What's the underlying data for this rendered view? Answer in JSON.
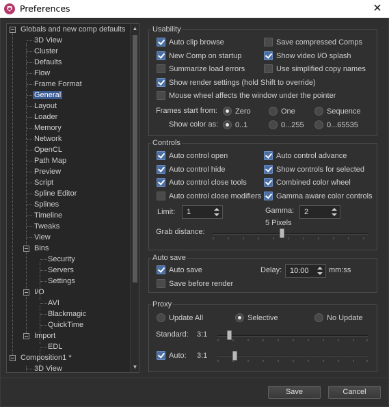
{
  "window": {
    "title": "Preferences"
  },
  "tree": {
    "items": [
      {
        "label": "Globals and new comp defaults"
      },
      {
        "label": "3D View"
      },
      {
        "label": "Cluster"
      },
      {
        "label": "Defaults"
      },
      {
        "label": "Flow"
      },
      {
        "label": "Frame Format"
      },
      {
        "label": "General"
      },
      {
        "label": "Layout"
      },
      {
        "label": "Loader"
      },
      {
        "label": "Memory"
      },
      {
        "label": "Network"
      },
      {
        "label": "OpenCL"
      },
      {
        "label": "Path Map"
      },
      {
        "label": "Preview"
      },
      {
        "label": "Script"
      },
      {
        "label": "Spline Editor"
      },
      {
        "label": "Splines"
      },
      {
        "label": "Timeline"
      },
      {
        "label": "Tweaks"
      },
      {
        "label": "View"
      },
      {
        "label": "Bins"
      },
      {
        "label": "Security"
      },
      {
        "label": "Servers"
      },
      {
        "label": "Settings"
      },
      {
        "label": "I/O"
      },
      {
        "label": "AVI"
      },
      {
        "label": "Blackmagic"
      },
      {
        "label": "QuickTime"
      },
      {
        "label": "Import"
      },
      {
        "label": "EDL"
      },
      {
        "label": "Composition1 *"
      },
      {
        "label": "3D View"
      }
    ],
    "selected": "General"
  },
  "usability": {
    "title": "Usability",
    "auto_clip_browse": "Auto clip browse",
    "save_compressed": "Save compressed Comps",
    "new_comp_startup": "New Comp on startup",
    "show_video_io": "Show video I/O splash",
    "summarize_load": "Summarize load errors",
    "simplified_names": "Use simplified copy names",
    "show_render_settings": "Show render settings (hold Shift to override)",
    "mouse_wheel": "Mouse wheel affects the window under the pointer",
    "frames_start_label": "Frames start from:",
    "frames_zero": "Zero",
    "frames_one": "One",
    "frames_sequence": "Sequence",
    "show_color_label": "Show color as:",
    "color_01": "0..1",
    "color_0255": "0...255",
    "color_065535": "0...65535"
  },
  "controls": {
    "title": "Controls",
    "auto_open": "Auto control open",
    "auto_advance": "Auto control advance",
    "auto_hide": "Auto control hide",
    "show_selected": "Show controls for selected",
    "auto_close_tools": "Auto control close tools",
    "combined_wheel": "Combined color wheel",
    "auto_close_modifiers": "Auto control close modifiers",
    "gamma_aware": "Gamma aware color controls",
    "limit_label": "Limit:",
    "limit_value": "1",
    "gamma_label": "Gamma:",
    "gamma_value": "2",
    "grab_value_text": "5  Pixels",
    "grab_label": "Grab distance:",
    "grab_level": 0.45
  },
  "autosave": {
    "title": "Auto save",
    "auto_save": "Auto save",
    "delay_label": "Delay:",
    "delay_value": "10:00",
    "delay_unit": "mm:ss",
    "before_render": "Save before render"
  },
  "proxy": {
    "title": "Proxy",
    "update_all": "Update All",
    "selective": "Selective",
    "no_update": "No Update",
    "standard_label": "Standard:",
    "standard_value": "3:1",
    "auto_label": "Auto:",
    "auto_value": "3:1",
    "standard_level": 0.08,
    "auto_level": 0.12
  },
  "footer": {
    "save": "Save",
    "cancel": "Cancel"
  }
}
